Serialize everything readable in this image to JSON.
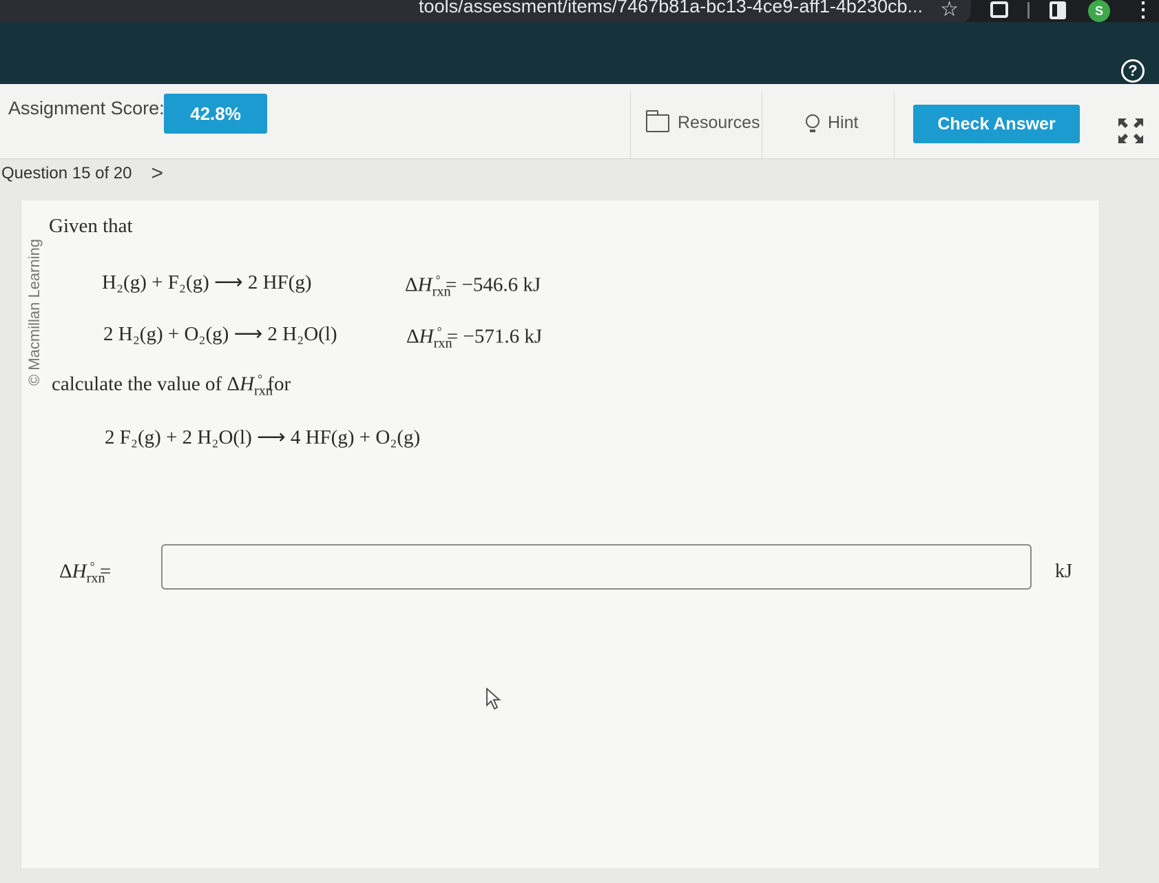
{
  "browser": {
    "url_fragment": "tools/assessment/items/7467b81a-bc13-4ce9-aff1-4b230cb...",
    "avatar_letter": "S"
  },
  "toolbar": {
    "score_label": "Assignment Score:",
    "score_value": "42.8%",
    "resources_label": "Resources",
    "hint_label": "Hint",
    "check_answer_label": "Check Answer"
  },
  "navigation": {
    "question_label": "Question 15 of 20"
  },
  "question": {
    "copyright": "© Macmillan Learning",
    "given_that": "Given that",
    "reaction1": {
      "reactants": "H₂(g) + F₂(g)",
      "products": "2 HF(g)",
      "dh_value": "= −546.6 kJ"
    },
    "reaction2": {
      "reactants": "2 H₂(g) + O₂(g)",
      "products": "2 H₂O(l)",
      "dh_value": "= −571.6 kJ"
    },
    "prompt_before": "calculate the value of",
    "prompt_after": "for",
    "target_reaction": {
      "reactants": "2 F₂(g) + 2 H₂O(l)",
      "products": "4 HF(g) + O₂(g)"
    },
    "answer_equals": "=",
    "answer_value": "",
    "answer_unit": "kJ"
  },
  "colors": {
    "header": "#16323b",
    "accent": "#1c9bd0"
  }
}
